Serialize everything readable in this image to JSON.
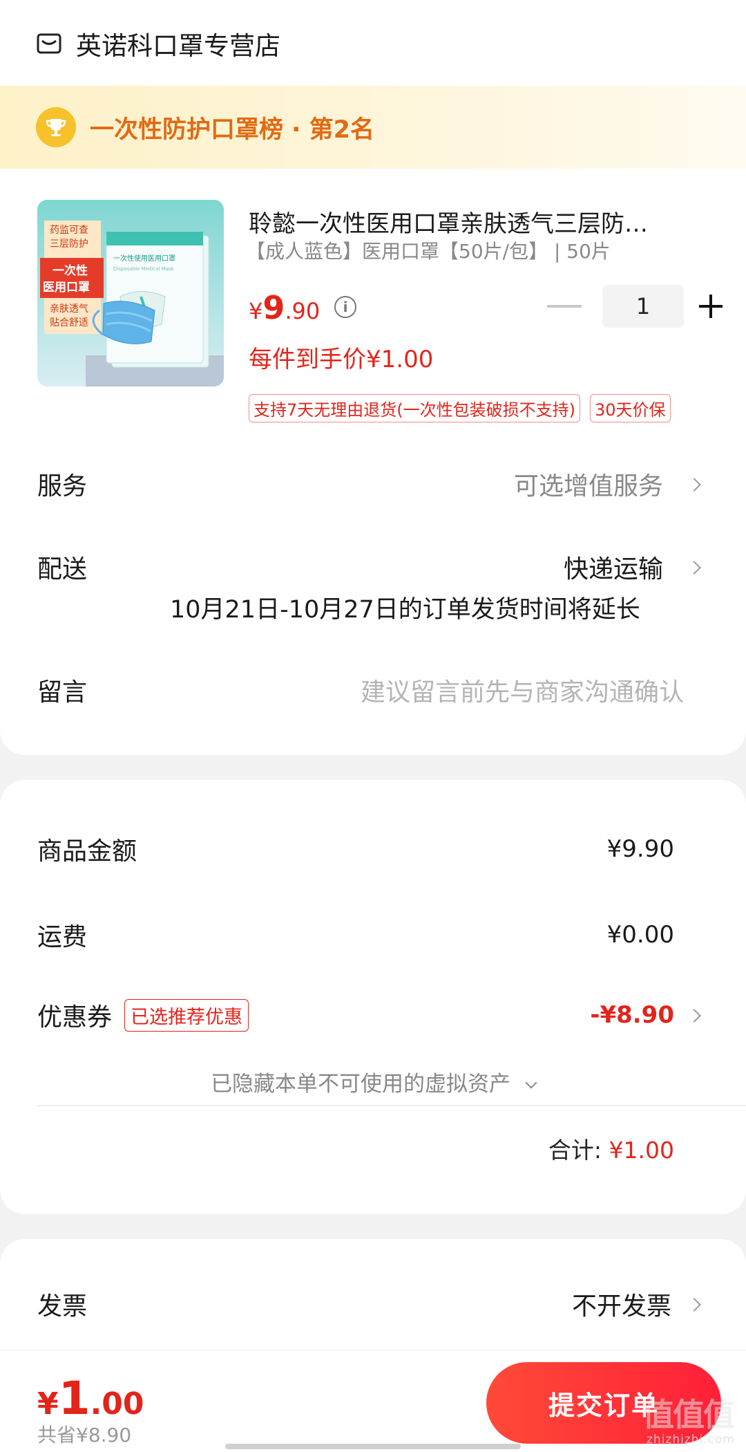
{
  "store": {
    "name": "英诺科口罩专营店",
    "icon": "store-icon"
  },
  "rank": {
    "text": "一次性防护口罩榜 · 第2名",
    "icon": "trophy-icon"
  },
  "product": {
    "title": "聆懿一次性医用口罩亲肤透气三层防…",
    "spec": "【成人蓝色】医用口罩【50片/包】 | 50片",
    "price_symbol": "¥",
    "price_int": "9",
    "price_dec": ".90",
    "quantity": "1",
    "unit_price": "每件到手价¥1.00",
    "tags": [
      "支持7天无理由退货(一次性包装破损不支持)",
      "30天价保"
    ],
    "image_text": {
      "badge_line1": "药监可查",
      "badge_line2": "三层防护",
      "badge_main1": "一次性",
      "badge_main2": "医用口罩",
      "badge_line3": "亲肤透气",
      "badge_line4": "贴合舒适",
      "pack_cn": "一次性使用医用口罩",
      "pack_en": "Disposable Medical Mask"
    }
  },
  "service": {
    "label": "服务",
    "value": "可选增值服务"
  },
  "delivery": {
    "label": "配送",
    "value": "快递运输",
    "note": "10月21日-10月27日的订单发货时间将延长"
  },
  "message": {
    "label": "留言",
    "placeholder": "建议留言前先与商家沟通确认"
  },
  "summary": {
    "goods_label": "商品金额",
    "goods_value": "¥9.90",
    "shipping_label": "运费",
    "shipping_value": "¥0.00",
    "coupon_label": "优惠券",
    "coupon_badge": "已选推荐优惠",
    "coupon_value": "-¥8.90",
    "hidden_assets": "已隐藏本单不可使用的虚拟资产",
    "total_label": "合计:",
    "total_value": "¥1.00"
  },
  "invoice": {
    "label": "发票",
    "value": "不开发票"
  },
  "bottom": {
    "price_symbol": "¥",
    "price_int": "1",
    "price_dec": ".00",
    "saved": "共省¥8.90",
    "submit_label": "提交订单"
  },
  "watermark": {
    "text": "值值值",
    "sub": "zhizhizhi.com"
  },
  "colors": {
    "accent": "#e3241b",
    "button": "#ff2d3b",
    "rank_text": "#e26a12",
    "banner_bg": "#fdf1c8"
  }
}
